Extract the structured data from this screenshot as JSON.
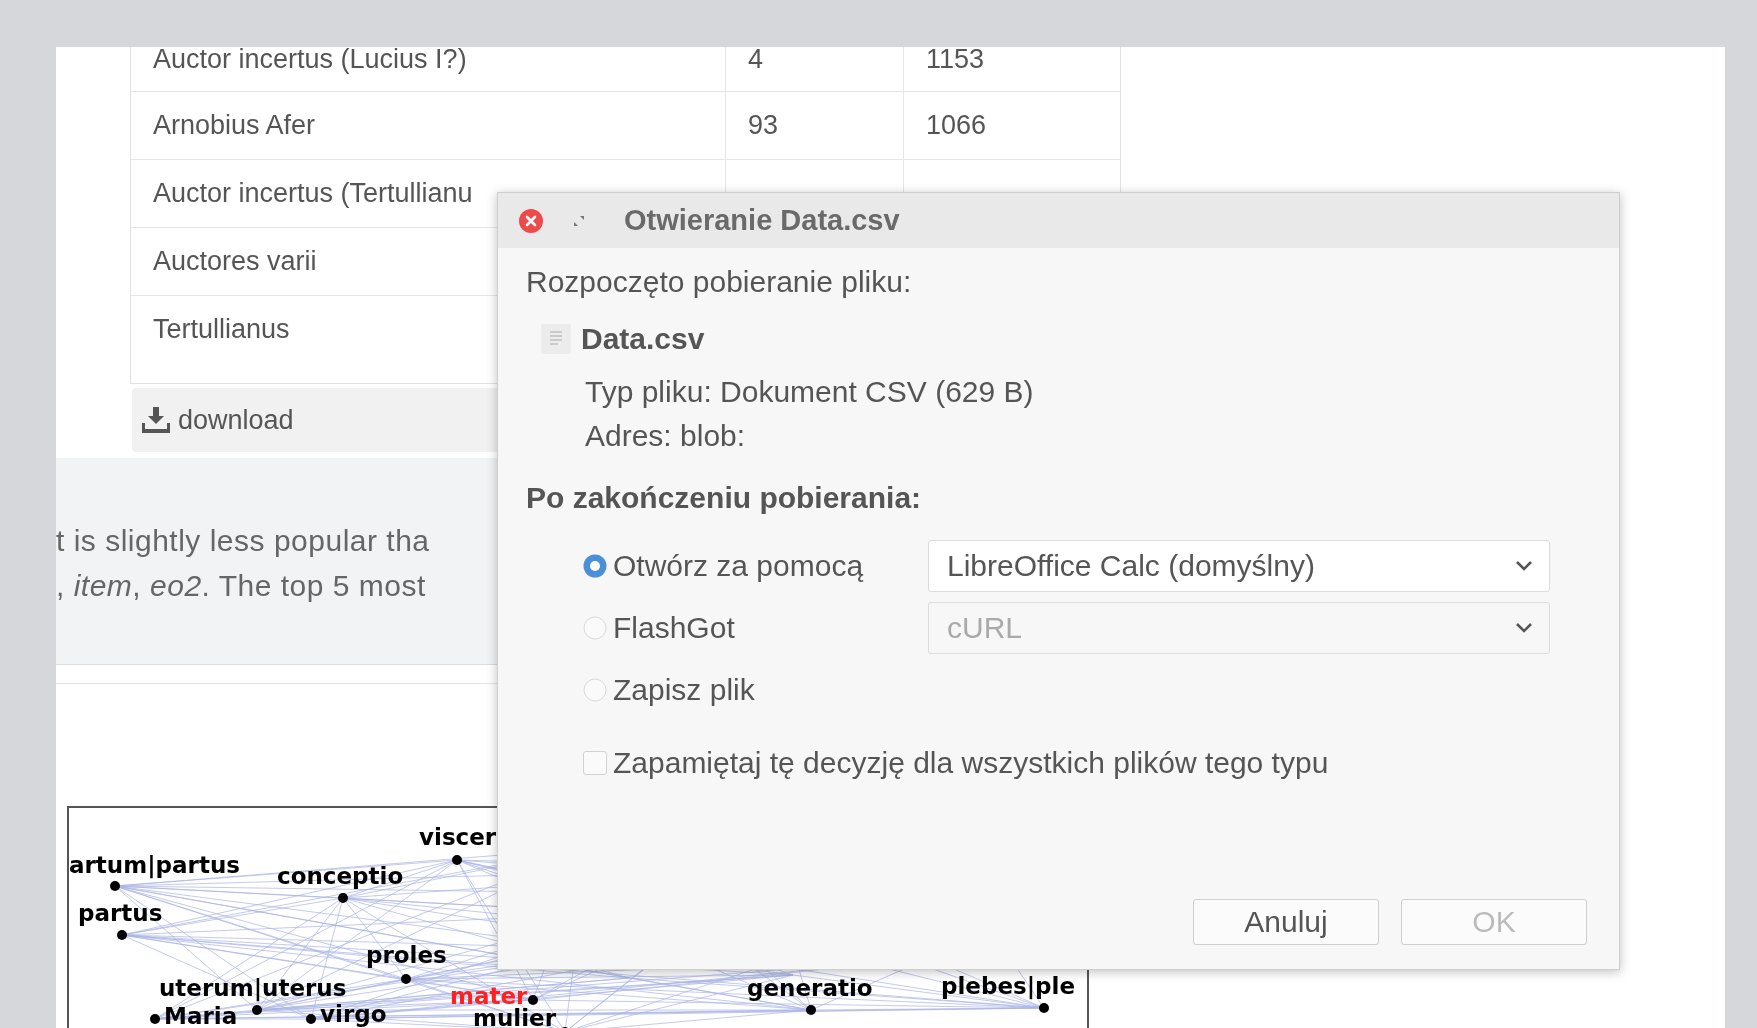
{
  "table": {
    "rows": [
      {
        "cells": [
          "Auctor incertus (Lucius I?)",
          "4",
          "1153"
        ]
      },
      {
        "cells": [
          "Arnobius Afer",
          "93",
          "1066"
        ]
      },
      {
        "cells": [
          "Auctor incertus (Tertullianu"
        ]
      },
      {
        "cells": [
          "Auctores varii"
        ]
      },
      {
        "cells": [
          "Tertullianus"
        ]
      }
    ]
  },
  "download_button": {
    "label": "download"
  },
  "info_panel": {
    "lines": [
      "t is slightly less popular tha",
      ", *item*, *eo2*. The top 5 most"
    ]
  },
  "graph": {
    "nodes": [
      {
        "label": "viscer",
        "color": "#000000"
      },
      {
        "label": "artum|partus",
        "color": "#000000"
      },
      {
        "label": "conceptio",
        "color": "#000000"
      },
      {
        "label": "partus",
        "color": "#000000"
      },
      {
        "label": "proles",
        "color": "#000000"
      },
      {
        "label": "uterum|uterus",
        "color": "#000000"
      },
      {
        "label": "mater",
        "color": "#ff2020"
      },
      {
        "label": "Maria",
        "color": "#000000"
      },
      {
        "label": "virgo",
        "color": "#000000"
      },
      {
        "label": "mulier",
        "color": "#000000"
      },
      {
        "label": "generatio",
        "color": "#000000"
      },
      {
        "label": "plebes|ple",
        "color": "#000000"
      }
    ]
  },
  "dialog": {
    "title": "Otwieranie Data.csv",
    "intro": "Rozpoczęto pobieranie pliku:",
    "file_name": "Data.csv",
    "file_type": "Typ pliku: Dokument CSV (629 B)",
    "address": "Adres: blob:",
    "section_title": "Po zakończeniu pobierania:",
    "options": [
      {
        "label": "Otwórz za pomocą",
        "selected": true,
        "dropdown": {
          "value": "LibreOffice Calc (domyślny)",
          "disabled": false
        }
      },
      {
        "label": "FlashGot",
        "selected": false,
        "dropdown": {
          "value": "cURL",
          "disabled": true
        }
      },
      {
        "label": "Zapisz plik",
        "selected": false
      }
    ],
    "remember": {
      "label": "Zapamiętaj tę decyzję dla wszystkich plików tego typu",
      "checked": false
    },
    "buttons": [
      {
        "label": "Anuluj",
        "disabled": false
      },
      {
        "label": "OK",
        "disabled": true
      }
    ]
  }
}
